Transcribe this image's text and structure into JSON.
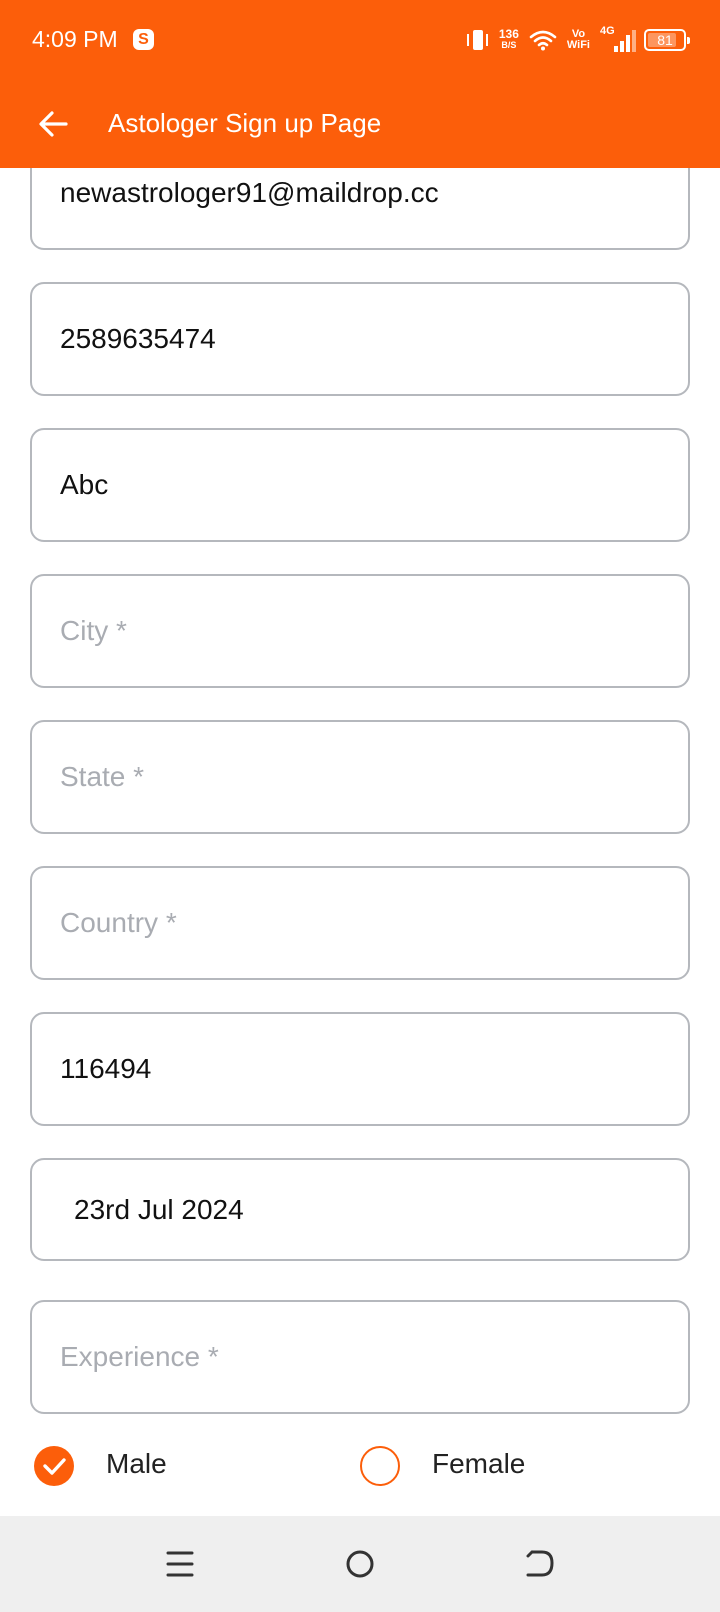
{
  "status_bar": {
    "time": "4:09 PM",
    "net_speed_value": "136",
    "net_speed_unit": "B/S",
    "vowifi_top": "Vo",
    "vowifi_bottom": "WiFi",
    "network_type": "4G",
    "battery_level": "81",
    "icons": [
      "skype-icon",
      "vibrate-icon",
      "wifi-icon",
      "signal-icon",
      "battery-icon"
    ]
  },
  "app_bar": {
    "title": "Astologer Sign up Page",
    "back_icon": "arrow-left-icon",
    "color": "#fc5e0a"
  },
  "form": {
    "email_value": "newastrologer91@maildrop.cc",
    "phone_value": "2589635474",
    "address_value": "Abc",
    "city_placeholder": "City *",
    "state_placeholder": "State *",
    "country_placeholder": "Country *",
    "pincode_value": "116494",
    "date_value": "23rd Jul 2024",
    "experience_placeholder": "Experience *"
  },
  "gender": {
    "options": [
      "Male",
      "Female"
    ],
    "selected": "Male"
  },
  "nav_bar": {
    "icons": [
      "menu-icon",
      "home-icon",
      "back-icon"
    ]
  }
}
